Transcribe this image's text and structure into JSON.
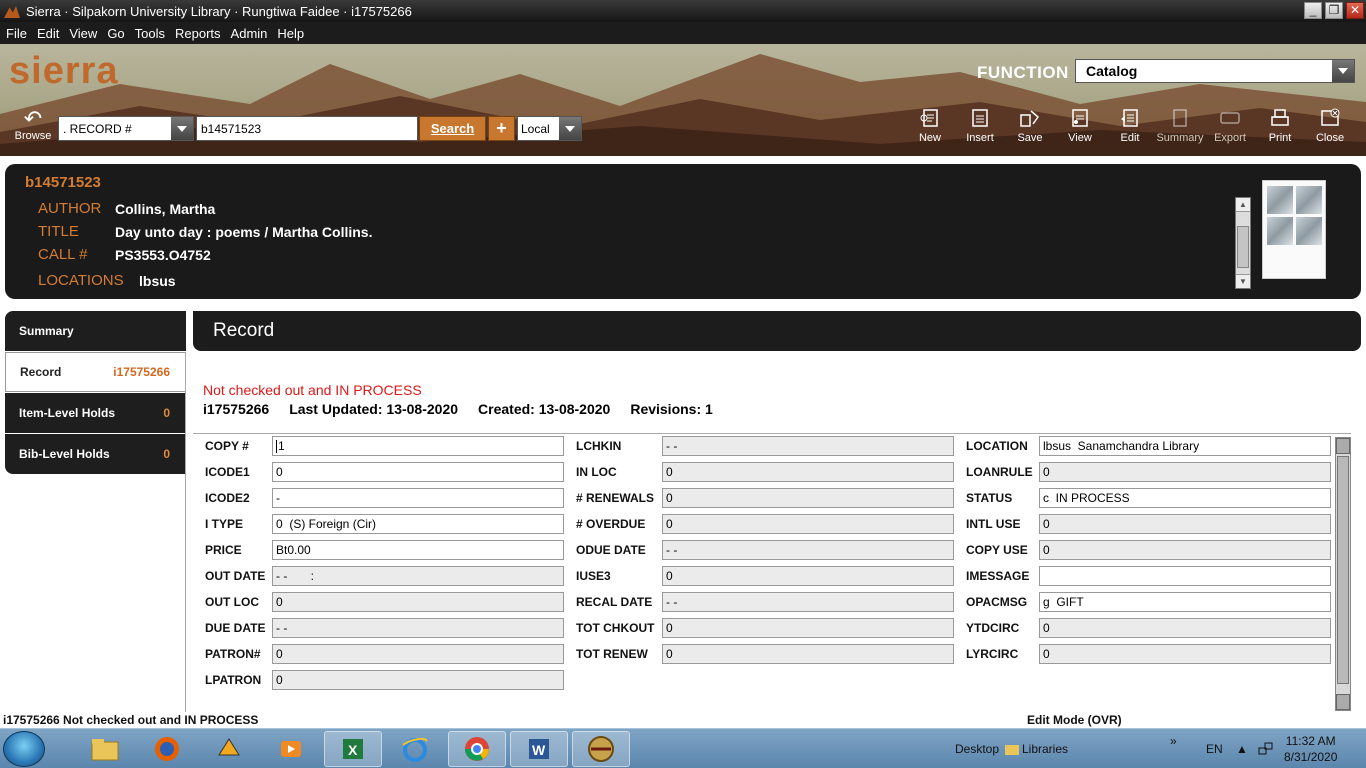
{
  "window": {
    "title": "Sierra · Silpakorn University Library · Rungtiwa Faidee · i17575266"
  },
  "menu": [
    "File",
    "Edit",
    "View",
    "Go",
    "Tools",
    "Reports",
    "Admin",
    "Help"
  ],
  "app": {
    "logo": "sierra",
    "function_label": "FUNCTION",
    "function_value": "Catalog"
  },
  "toolbar": {
    "browse": "Browse",
    "record_type": ". RECORD #",
    "search_value": "b14571523",
    "search_label": "Search",
    "plus_label": "+",
    "scope": "Local",
    "tools": [
      {
        "label": "New",
        "icon": "new-record-icon",
        "enabled": true
      },
      {
        "label": "Insert",
        "icon": "insert-icon",
        "enabled": true
      },
      {
        "label": "Save",
        "icon": "save-icon",
        "enabled": true
      },
      {
        "label": "View",
        "icon": "view-icon",
        "enabled": true
      },
      {
        "label": "Edit",
        "icon": "edit-icon",
        "enabled": true
      },
      {
        "label": "Summary",
        "icon": "summary-icon",
        "enabled": false
      },
      {
        "label": "Export",
        "icon": "export-icon",
        "enabled": false
      },
      {
        "label": "Print",
        "icon": "print-icon",
        "enabled": true
      },
      {
        "label": "Close",
        "icon": "close-icon",
        "enabled": true
      }
    ]
  },
  "bib": {
    "number": "b14571523",
    "author_label": "AUTHOR",
    "author": "Collins, Martha",
    "title_label": "TITLE",
    "title": "Day unto day : poems / Martha Collins.",
    "call_label": "CALL #",
    "call": "PS3553.O4752",
    "loc_label": "LOCATIONS",
    "loc": "lbsus"
  },
  "nav": [
    {
      "label": "Summary",
      "count": ""
    },
    {
      "label": "Record",
      "count": "i17575266"
    },
    {
      "label": "Item-Level Holds",
      "count": "0"
    },
    {
      "label": "Bib-Level Holds",
      "count": "0"
    }
  ],
  "record": {
    "heading": "Record",
    "status": "Not checked out and IN PROCESS",
    "id": "i17575266",
    "last_updated": "Last Updated: 13-08-2020",
    "created": "Created: 13-08-2020",
    "revisions": "Revisions: 1"
  },
  "fields": {
    "col1": [
      {
        "label": "COPY #",
        "value": "1",
        "editable": true
      },
      {
        "label": "ICODE1",
        "value": "0",
        "editable": true
      },
      {
        "label": "ICODE2",
        "value": "-",
        "editable": true
      },
      {
        "label": "I TYPE",
        "value": "0  (S) Foreign (Cir)",
        "editable": true
      },
      {
        "label": "PRICE",
        "value": "Bt0.00",
        "editable": true
      },
      {
        "label": "OUT DATE",
        "value": "- -       :",
        "editable": false
      },
      {
        "label": "OUT LOC",
        "value": "0",
        "editable": false
      },
      {
        "label": "DUE DATE",
        "value": "- -",
        "editable": false
      },
      {
        "label": "PATRON#",
        "value": "0",
        "editable": false
      },
      {
        "label": "LPATRON",
        "value": "0",
        "editable": false
      }
    ],
    "col2": [
      {
        "label": "LCHKIN",
        "value": "- -",
        "editable": false
      },
      {
        "label": "IN LOC",
        "value": "0",
        "editable": false
      },
      {
        "label": "# RENEWALS",
        "value": "0",
        "editable": false
      },
      {
        "label": "# OVERDUE",
        "value": "0",
        "editable": false
      },
      {
        "label": "ODUE DATE",
        "value": "- -",
        "editable": false
      },
      {
        "label": "IUSE3",
        "value": "0",
        "editable": false
      },
      {
        "label": "RECAL DATE",
        "value": "- -",
        "editable": false
      },
      {
        "label": "TOT CHKOUT",
        "value": "0",
        "editable": false
      },
      {
        "label": "TOT RENEW",
        "value": "0",
        "editable": false
      }
    ],
    "col3": [
      {
        "label": "LOCATION",
        "value": "lbsus  Sanamchandra Library",
        "editable": true
      },
      {
        "label": "LOANRULE",
        "value": "0",
        "editable": false
      },
      {
        "label": "STATUS",
        "value": "c  IN PROCESS",
        "editable": true
      },
      {
        "label": "INTL USE",
        "value": "0",
        "editable": false
      },
      {
        "label": "COPY USE",
        "value": "0",
        "editable": false
      },
      {
        "label": "IMESSAGE",
        "value": "",
        "editable": true
      },
      {
        "label": "OPACMSG",
        "value": "g  GIFT",
        "editable": true
      },
      {
        "label": "YTDCIRC",
        "value": "0",
        "editable": false
      },
      {
        "label": "LYRCIRC",
        "value": "0",
        "editable": false
      }
    ]
  },
  "statusbar": {
    "left": "i17575266  Not checked out and IN PROCESS",
    "right": "Edit Mode (OVR)"
  },
  "taskbar": {
    "desktop": "Desktop",
    "libraries": "Libraries",
    "lang": "EN",
    "chevron": "»",
    "time": "11:32 AM",
    "date": "8/31/2020"
  },
  "colors": {
    "accent": "#c8772e",
    "label_orange": "#d47c33",
    "status_red": "#e01818",
    "panel_dark": "#1a1a1a"
  }
}
